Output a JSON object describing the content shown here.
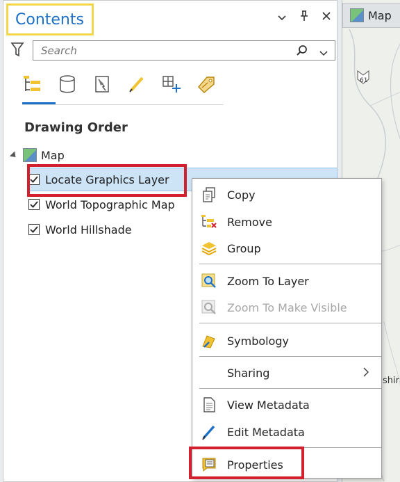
{
  "contents_pane": {
    "title": "Contents",
    "controls": {
      "menu": "⌄",
      "pin": "ᵖ",
      "close": "×"
    },
    "search": {
      "placeholder": "Search",
      "value": ""
    },
    "toolbar": [
      "list-by-drawing-order-icon",
      "list-by-data-source-icon",
      "list-by-selection-icon",
      "list-by-editing-icon",
      "list-by-snapping-icon",
      "list-by-labeling-icon"
    ],
    "section_title": "Drawing Order",
    "map_label": "Map",
    "layers": [
      {
        "label": "Locate Graphics Layer",
        "checked": true,
        "selected": true
      },
      {
        "label": "World Topographic Map",
        "checked": true,
        "selected": false
      },
      {
        "label": "World Hillshade",
        "checked": true,
        "selected": false
      }
    ]
  },
  "map_view": {
    "tab_label": "Map",
    "route_label": "61",
    "place_fragment": "shir"
  },
  "context_menu": {
    "items": [
      {
        "label": "Copy",
        "icon": "copy-icon",
        "enabled": true
      },
      {
        "label": "Remove",
        "icon": "remove-icon",
        "enabled": true
      },
      {
        "label": "Group",
        "icon": "group-icon",
        "enabled": true
      },
      {
        "label": "Zoom To Layer",
        "icon": "zoom-to-layer-icon",
        "enabled": true
      },
      {
        "label": "Zoom To Make Visible",
        "icon": "zoom-to-make-visible-icon",
        "enabled": false
      },
      {
        "label": "Symbology",
        "icon": "symbology-icon",
        "enabled": true
      },
      {
        "label": "Sharing",
        "icon": "",
        "enabled": true,
        "submenu": true,
        "arrow": ">"
      },
      {
        "label": "View Metadata",
        "icon": "view-metadata-icon",
        "enabled": true
      },
      {
        "label": "Edit Metadata",
        "icon": "edit-metadata-icon",
        "enabled": true
      },
      {
        "label": "Properties",
        "icon": "properties-icon",
        "enabled": true
      }
    ]
  },
  "colors": {
    "accent": "#1e6fc6",
    "highlight": "#d3202e",
    "title_box": "#f2d64b",
    "selection": "#cde4f7"
  }
}
